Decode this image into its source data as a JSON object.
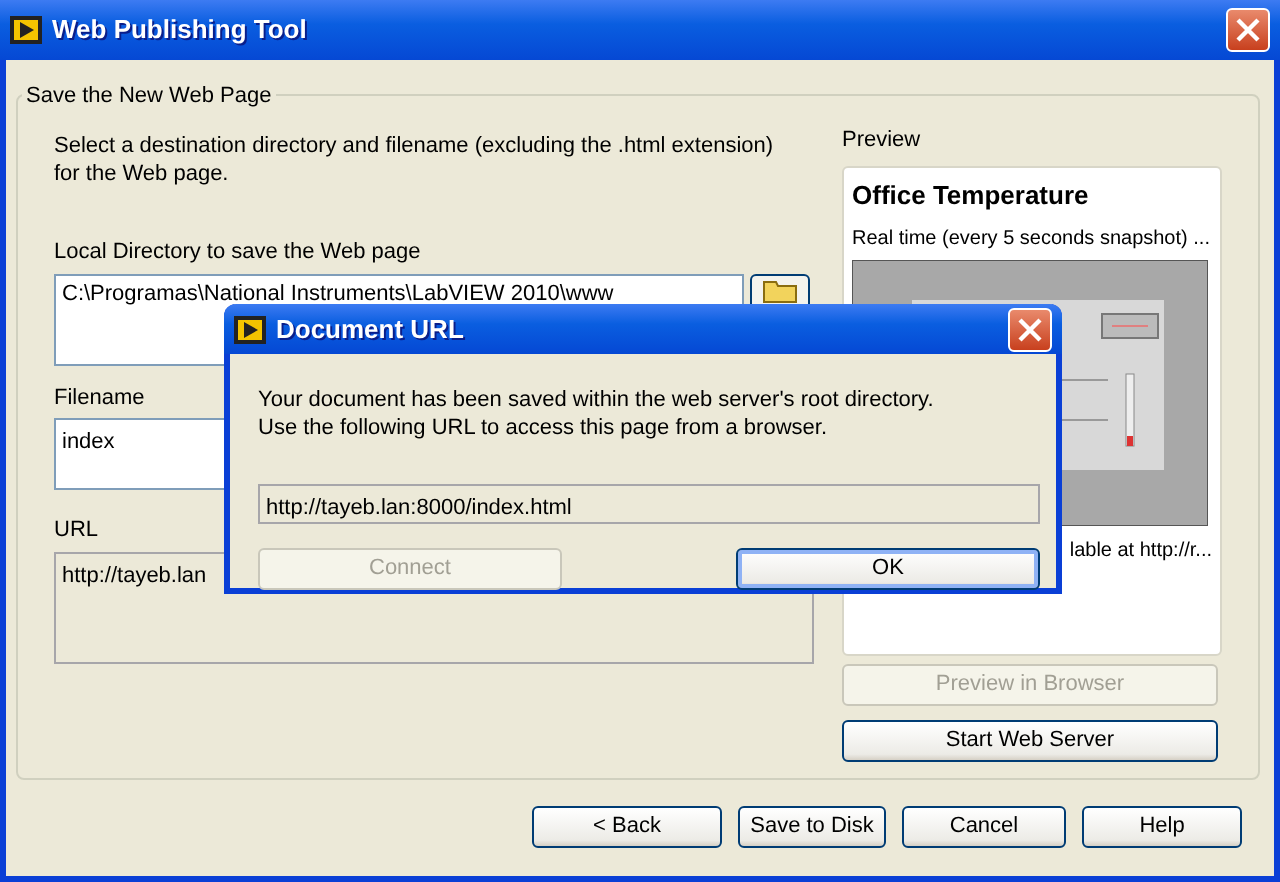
{
  "window": {
    "title": "Web Publishing Tool"
  },
  "group": {
    "title": "Save the New Web Page"
  },
  "instructions": "Select a destination directory and filename (excluding the .html extension) for the Web page.",
  "fields": [
    {
      "kind": "directory",
      "label": "Local Directory to save the Web page",
      "value": "C:\\Programas\\National Instruments\\LabVIEW 2010\\www"
    },
    {
      "kind": "text",
      "label": "Filename",
      "value": "index"
    },
    {
      "kind": "url",
      "label": "URL",
      "value": "http://tayeb.lan"
    }
  ],
  "preview": {
    "label": "Preview",
    "title": "Office Temperature",
    "subtitle": "Real time (every 5 seconds snapshot) ...",
    "footer": "lable at http://r..."
  },
  "side_buttons": [
    {
      "label": "Preview in Browser",
      "disabled": true
    },
    {
      "label": "Start Web Server",
      "disabled": false
    }
  ],
  "footer_buttons": [
    {
      "label": "< Back"
    },
    {
      "label": "Save to Disk"
    },
    {
      "label": "Cancel"
    },
    {
      "label": "Help"
    }
  ],
  "dialog": {
    "title": "Document URL",
    "message": "Your document has been saved within the web server's root directory.\nUse the following URL to access this page from a browser.",
    "url": "http://tayeb.lan:8000/index.html",
    "buttons": [
      {
        "label": "Connect",
        "disabled": true,
        "default": false
      },
      {
        "label": "OK",
        "disabled": false,
        "default": true
      }
    ]
  }
}
